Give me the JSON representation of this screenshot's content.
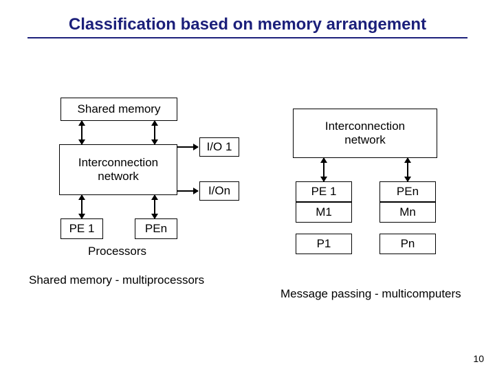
{
  "title": "Classification based on memory arrangement",
  "left": {
    "shared_memory": "Shared memory",
    "interconnection": "Interconnection\nnetwork",
    "io": {
      "io1": "I/O 1",
      "ion": "I/On"
    },
    "pe": {
      "pe1": "PE 1",
      "pen": "PEn"
    },
    "processors_label": "Processors",
    "caption": "Shared memory - multiprocessors"
  },
  "right": {
    "interconnection": "Interconnection\nnetwork",
    "pe": {
      "pe1": "PE 1",
      "pen": "PEn"
    },
    "m": {
      "m1": "M1",
      "mn": "Mn"
    },
    "p": {
      "p1": "P1",
      "pn": "Pn"
    },
    "caption": "Message passing - multicomputers"
  },
  "page": "10"
}
